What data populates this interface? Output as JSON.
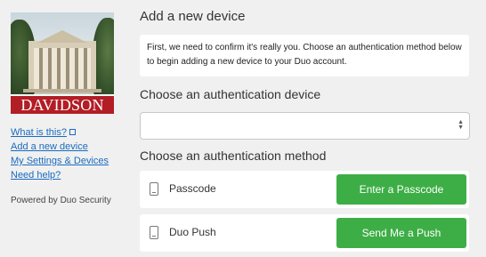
{
  "sidebar": {
    "logo_text": "DAVIDSON",
    "links": [
      "What is this?",
      "Add a new device",
      "My Settings & Devices",
      "Need help?"
    ],
    "powered_by": "Powered by Duo Security"
  },
  "main": {
    "title": "Add a new device",
    "info_text": "First, we need to confirm it's really you. Choose an authentication method below to begin adding a new device to your Duo account.",
    "device_heading": "Choose an authentication device",
    "device_select_value": "",
    "method_heading": "Choose an authentication method",
    "methods": [
      {
        "label": "Passcode",
        "icon": "passcode-device-icon",
        "button": "Enter a Passcode"
      },
      {
        "label": "Duo Push",
        "icon": "push-device-icon",
        "button": "Send Me a Push"
      }
    ]
  },
  "colors": {
    "button_green": "#3dae46",
    "link_blue": "#1a6bbf",
    "logo_red": "#b21d26",
    "background": "#f0f0f0"
  }
}
